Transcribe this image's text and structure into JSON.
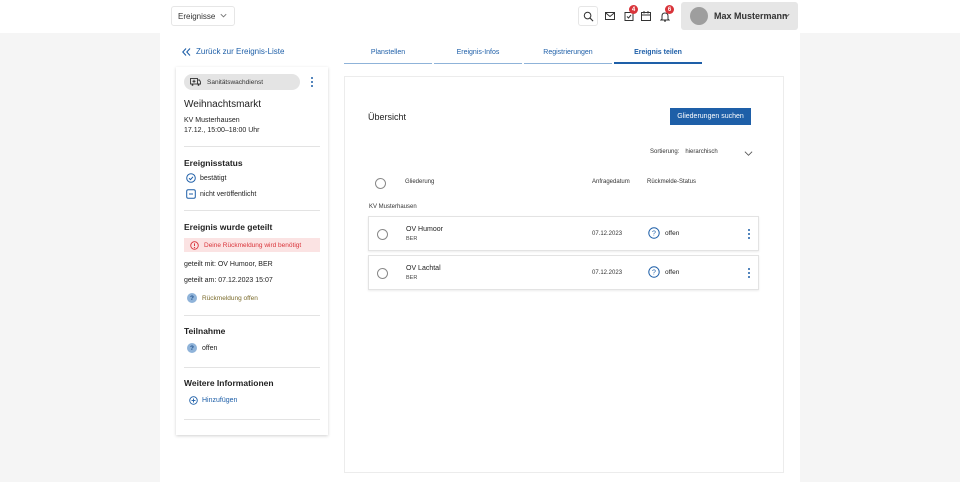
{
  "header": {
    "event_dropdown": "Ereignisse",
    "mail_badge": "4",
    "bell_badge": "6",
    "user_name": "Max Mustermann"
  },
  "back_link": "Zurück zur Ereignis-Liste",
  "event": {
    "tag": "Sanitätswachdienst",
    "title": "Weihnachtsmarkt",
    "organizer": "KV Musterhausen",
    "time": "17.12., 15:00–18:00 Uhr"
  },
  "status": {
    "heading": "Ereignisstatus",
    "confirmed": "bestätigt",
    "unpublished": "nicht veröffentlicht"
  },
  "shared": {
    "heading": "Ereignis wurde geteilt",
    "alert": "Deine Rückmeldung wird benötigt",
    "shared_with": "geteilt mit: OV Humoor, BER",
    "shared_on": "geteilt am: 07.12.2023 15:07",
    "feedback": "Rückmeldung offen"
  },
  "participation": {
    "heading": "Teilnahme",
    "value": "offen"
  },
  "more_info": {
    "heading": "Weitere Informationen",
    "add": "Hinzufügen"
  },
  "tabs": [
    "Planstellen",
    "Ereignis-Infos",
    "Registrierungen",
    "Ereignis teilen"
  ],
  "overview": {
    "title": "Übersicht",
    "search_button": "Gliederungen suchen",
    "sort_label": "Sortierung:",
    "sort_value": "hierarchisch",
    "columns": [
      "Gliederung",
      "Anfragedatum",
      "Rückmelde-Status"
    ],
    "group": "KV Musterhausen",
    "rows": [
      {
        "name": "OV Humoor",
        "sub": "BER",
        "date": "07.12.2023",
        "status": "offen"
      },
      {
        "name": "OV Lachtal",
        "sub": "BER",
        "date": "07.12.2023",
        "status": "offen"
      }
    ]
  },
  "colors": {
    "accent": "#1e5fa8",
    "alert_text": "#d9343a",
    "alert_bg": "#fbe3e3",
    "badge": "#d9343a"
  }
}
